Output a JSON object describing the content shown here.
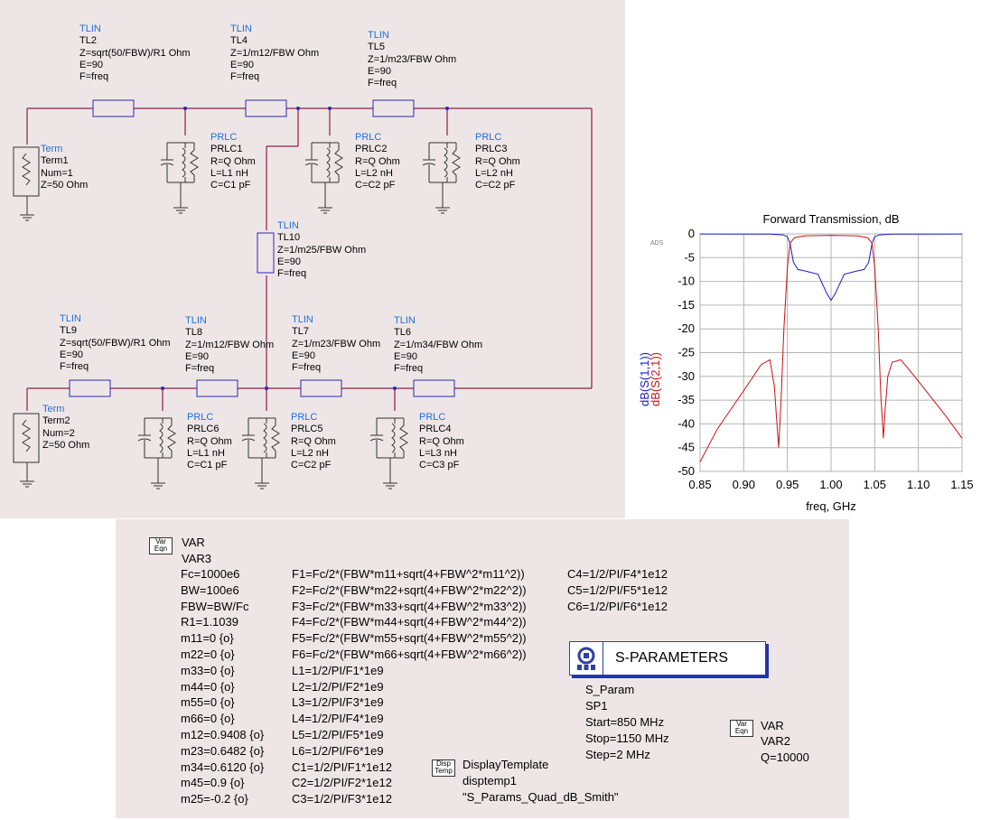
{
  "schematic": {
    "TL2": {
      "type": "TLIN",
      "name": "TL2",
      "z": "Z=sqrt(50/FBW)/R1 Ohm",
      "e": "E=90",
      "f": "F=freq"
    },
    "TL4": {
      "type": "TLIN",
      "name": "TL4",
      "z": "Z=1/m12/FBW Ohm",
      "e": "E=90",
      "f": "F=freq"
    },
    "TL5": {
      "type": "TLIN",
      "name": "TL5",
      "z": "Z=1/m23/FBW Ohm",
      "e": "E=90",
      "f": "F=freq"
    },
    "TL10": {
      "type": "TLIN",
      "name": "TL10",
      "z": "Z=1/m25/FBW Ohm",
      "e": "E=90",
      "f": "F=freq"
    },
    "TL9": {
      "type": "TLIN",
      "name": "TL9",
      "z": "Z=sqrt(50/FBW)/R1 Ohm",
      "e": "E=90",
      "f": "F=freq"
    },
    "TL8": {
      "type": "TLIN",
      "name": "TL8",
      "z": "Z=1/m12/FBW Ohm",
      "e": "E=90",
      "f": "F=freq"
    },
    "TL7": {
      "type": "TLIN",
      "name": "TL7",
      "z": "Z=1/m23/FBW Ohm",
      "e": "E=90",
      "f": "F=freq"
    },
    "TL6": {
      "type": "TLIN",
      "name": "TL6",
      "z": "Z=1/m34/FBW Ohm",
      "e": "E=90",
      "f": "F=freq"
    },
    "Term1": {
      "type": "Term",
      "name": "Term1",
      "num": "Num=1",
      "z": "Z=50 Ohm"
    },
    "Term2": {
      "type": "Term",
      "name": "Term2",
      "num": "Num=2",
      "z": "Z=50 Ohm"
    },
    "PRLC1": {
      "type": "PRLC",
      "name": "PRLC1",
      "r": "R=Q Ohm",
      "l": "L=L1 nH",
      "c": "C=C1 pF"
    },
    "PRLC2": {
      "type": "PRLC",
      "name": "PRLC2",
      "r": "R=Q Ohm",
      "l": "L=L2 nH",
      "c": "C=C2 pF"
    },
    "PRLC3": {
      "type": "PRLC",
      "name": "PRLC3",
      "r": "R=Q Ohm",
      "l": "L=L2 nH",
      "c": "C=C2 pF"
    },
    "PRLC6": {
      "type": "PRLC",
      "name": "PRLC6",
      "r": "R=Q Ohm",
      "l": "L=L1 nH",
      "c": "C=C1 pF"
    },
    "PRLC5": {
      "type": "PRLC",
      "name": "PRLC5",
      "r": "R=Q Ohm",
      "l": "L=L2 nH",
      "c": "C=C2 pF"
    },
    "PRLC4": {
      "type": "PRLC",
      "name": "PRLC4",
      "r": "R=Q Ohm",
      "l": "L=L3 nH",
      "c": "C=C3 pF"
    }
  },
  "chart_data": {
    "type": "line",
    "title": "Forward Transmission, dB",
    "xlabel": "freq, GHz",
    "ylabel_series": [
      "dB(S(1,1))",
      "dB(S(2,1))"
    ],
    "xlim": [
      0.85,
      1.15
    ],
    "ylim": [
      -50,
      0
    ],
    "xticks": [
      "0.85",
      "0.90",
      "0.95",
      "1.00",
      "1.05",
      "1.10",
      "1.15"
    ],
    "yticks": [
      "0",
      "-5",
      "-10",
      "-15",
      "-20",
      "-25",
      "-30",
      "-35",
      "-40",
      "-45",
      "-50"
    ],
    "watermark": "ADS",
    "grid": true,
    "colors": {
      "s11": "#1a1acc",
      "s21": "#cc1111",
      "grid": "#b4b4b4"
    },
    "series": [
      {
        "name": "dB(S(1,1))",
        "x": [
          0.85,
          0.93,
          0.945,
          0.95,
          0.953,
          0.957,
          0.962,
          0.97,
          0.985,
          0.995,
          1.0,
          1.005,
          1.015,
          1.03,
          1.038,
          1.043,
          1.047,
          1.05,
          1.055,
          1.07,
          1.15
        ],
        "y": [
          -0.01,
          -0.05,
          -0.2,
          -0.6,
          -2,
          -6,
          -7.5,
          -7.8,
          -8.5,
          -12.5,
          -14,
          -12.5,
          -8.5,
          -7.8,
          -7.5,
          -6,
          -2,
          -0.6,
          -0.2,
          -0.05,
          -0.01
        ]
      },
      {
        "name": "dB(S(2,1))",
        "x": [
          0.85,
          0.87,
          0.9,
          0.92,
          0.93,
          0.935,
          0.938,
          0.94,
          0.943,
          0.946,
          0.95,
          0.953,
          0.958,
          0.97,
          1.0,
          1.03,
          1.042,
          1.047,
          1.05,
          1.054,
          1.057,
          1.06,
          1.062,
          1.065,
          1.07,
          1.08,
          1.1,
          1.13,
          1.15
        ],
        "y": [
          -48,
          -41,
          -33,
          -27.5,
          -26.5,
          -32,
          -40,
          -45,
          -34,
          -20,
          -7,
          -2,
          -0.8,
          -0.4,
          -0.3,
          -0.4,
          -0.8,
          -2,
          -7,
          -20,
          -34,
          -43,
          -37,
          -30,
          -27,
          -26.5,
          -31,
          -38,
          -43
        ]
      }
    ]
  },
  "vars": {
    "var3": {
      "tag": "VAR",
      "name": "VAR3",
      "icon": "Var Eqn",
      "col1": [
        "Fc=1000e6",
        "BW=100e6",
        "FBW=BW/Fc",
        "R1=1.1039",
        "m11=0 {o}",
        "m22=0 {o}",
        "m33=0 {o}",
        "m44=0 {o}",
        "m55=0 {o}",
        "m66=0 {o}",
        "m12=0.9408 {o}",
        "m23=0.6482 {o}",
        "m34=0.6120 {o}",
        "m45=0.9 {o}",
        "m25=-0.2 {o}"
      ],
      "col2": [
        "F1=Fc/2*(FBW*m11+sqrt(4+FBW^2*m11^2))",
        "F2=Fc/2*(FBW*m22+sqrt(4+FBW^2*m22^2))",
        "F3=Fc/2*(FBW*m33+sqrt(4+FBW^2*m33^2))",
        "F4=Fc/2*(FBW*m44+sqrt(4+FBW^2*m44^2))",
        "F5=Fc/2*(FBW*m55+sqrt(4+FBW^2*m55^2))",
        "F6=Fc/2*(FBW*m66+sqrt(4+FBW^2*m66^2))",
        "L1=1/2/PI/F1*1e9",
        "L2=1/2/PI/F2*1e9",
        "L3=1/2/PI/F3*1e9",
        "L4=1/2/PI/F4*1e9",
        "L5=1/2/PI/F5*1e9",
        "L6=1/2/PI/F6*1e9",
        "C1=1/2/PI/F1*1e12",
        "C2=1/2/PI/F2*1e12",
        "C3=1/2/PI/F3*1e12"
      ],
      "col3": [
        "C4=1/2/PI/F4*1e12",
        "C5=1/2/PI/F5*1e12",
        "C6=1/2/PI/F6*1e12"
      ]
    },
    "sparam": {
      "title": "S-PARAMETERS",
      "type": "S_Param",
      "name": "SP1",
      "start": "Start=850 MHz",
      "stop": "Stop=1150 MHz",
      "step": "Step=2 MHz"
    },
    "var2": {
      "tag": "VAR",
      "name": "VAR2",
      "icon": "Var Eqn",
      "q": "Q=10000"
    },
    "display": {
      "tag": "DisplayTemplate",
      "name": "disptemp1",
      "template": "\"S_Params_Quad_dB_Smith\"",
      "icon": "Disp Temp"
    }
  }
}
